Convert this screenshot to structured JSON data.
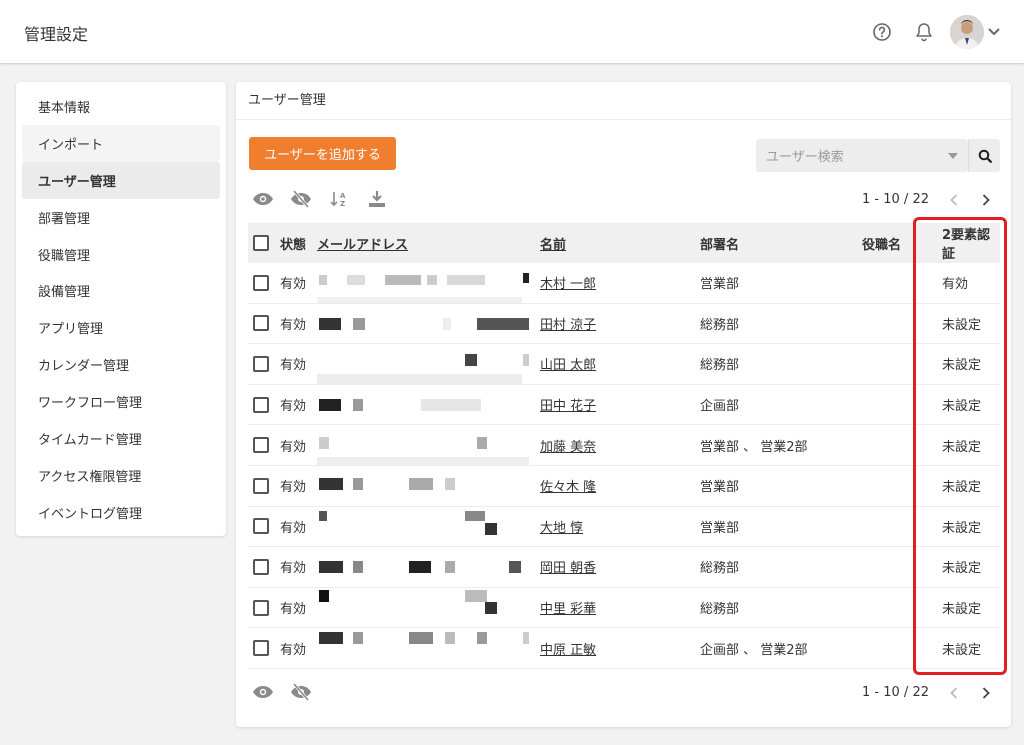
{
  "header": {
    "title": "管理設定",
    "icons": [
      "help-circle-icon",
      "bell-icon",
      "avatar",
      "chevron-down-icon"
    ]
  },
  "sidebar": {
    "items": [
      {
        "label": "基本情報",
        "state": "normal"
      },
      {
        "label": "インポート",
        "state": "hover"
      },
      {
        "label": "ユーザー管理",
        "state": "active"
      },
      {
        "label": "部署管理",
        "state": "normal"
      },
      {
        "label": "役職管理",
        "state": "normal"
      },
      {
        "label": "設備管理",
        "state": "normal"
      },
      {
        "label": "アプリ管理",
        "state": "normal"
      },
      {
        "label": "カレンダー管理",
        "state": "normal"
      },
      {
        "label": "ワークフロー管理",
        "state": "normal"
      },
      {
        "label": "タイムカード管理",
        "state": "normal"
      },
      {
        "label": "アクセス権限管理",
        "state": "normal"
      },
      {
        "label": "イベントログ管理",
        "state": "normal"
      }
    ]
  },
  "main": {
    "title": "ユーザー管理",
    "add_button": "ユーザーを追加する",
    "search_placeholder": "ユーザー検索",
    "pager_text": "1 - 10 / 22",
    "accent_color": "#f07e2f",
    "highlight_color": "#e02020",
    "table": {
      "headers": {
        "status": "状態",
        "email": "メールアドレス",
        "name": "名前",
        "dept": "部署名",
        "position": "役職名",
        "two_factor": "2要素認証"
      },
      "rows": [
        {
          "status": "有効",
          "name": "木村 一郎",
          "dept": "営業部",
          "position": "",
          "two_factor": "有効"
        },
        {
          "status": "有効",
          "name": "田村 涼子",
          "dept": "総務部",
          "position": "",
          "two_factor": "未設定"
        },
        {
          "status": "有効",
          "name": "山田 太郎",
          "dept": "総務部",
          "position": "",
          "two_factor": "未設定"
        },
        {
          "status": "有効",
          "name": "田中 花子",
          "dept": "企画部",
          "position": "",
          "two_factor": "未設定"
        },
        {
          "status": "有効",
          "name": "加藤 美奈",
          "dept": "営業部 、 営業2部",
          "position": "",
          "two_factor": "未設定"
        },
        {
          "status": "有効",
          "name": "佐々木 隆",
          "dept": "営業部",
          "position": "",
          "two_factor": "未設定"
        },
        {
          "status": "有効",
          "name": "大地 惇",
          "dept": "営業部",
          "position": "",
          "two_factor": "未設定"
        },
        {
          "status": "有効",
          "name": "岡田 朝香",
          "dept": "総務部",
          "position": "",
          "two_factor": "未設定"
        },
        {
          "status": "有効",
          "name": "中里 彩華",
          "dept": "総務部",
          "position": "",
          "two_factor": "未設定"
        },
        {
          "status": "有効",
          "name": "中原 正敏",
          "dept": "企画部 、 営業2部",
          "position": "",
          "two_factor": "未設定"
        }
      ]
    }
  }
}
